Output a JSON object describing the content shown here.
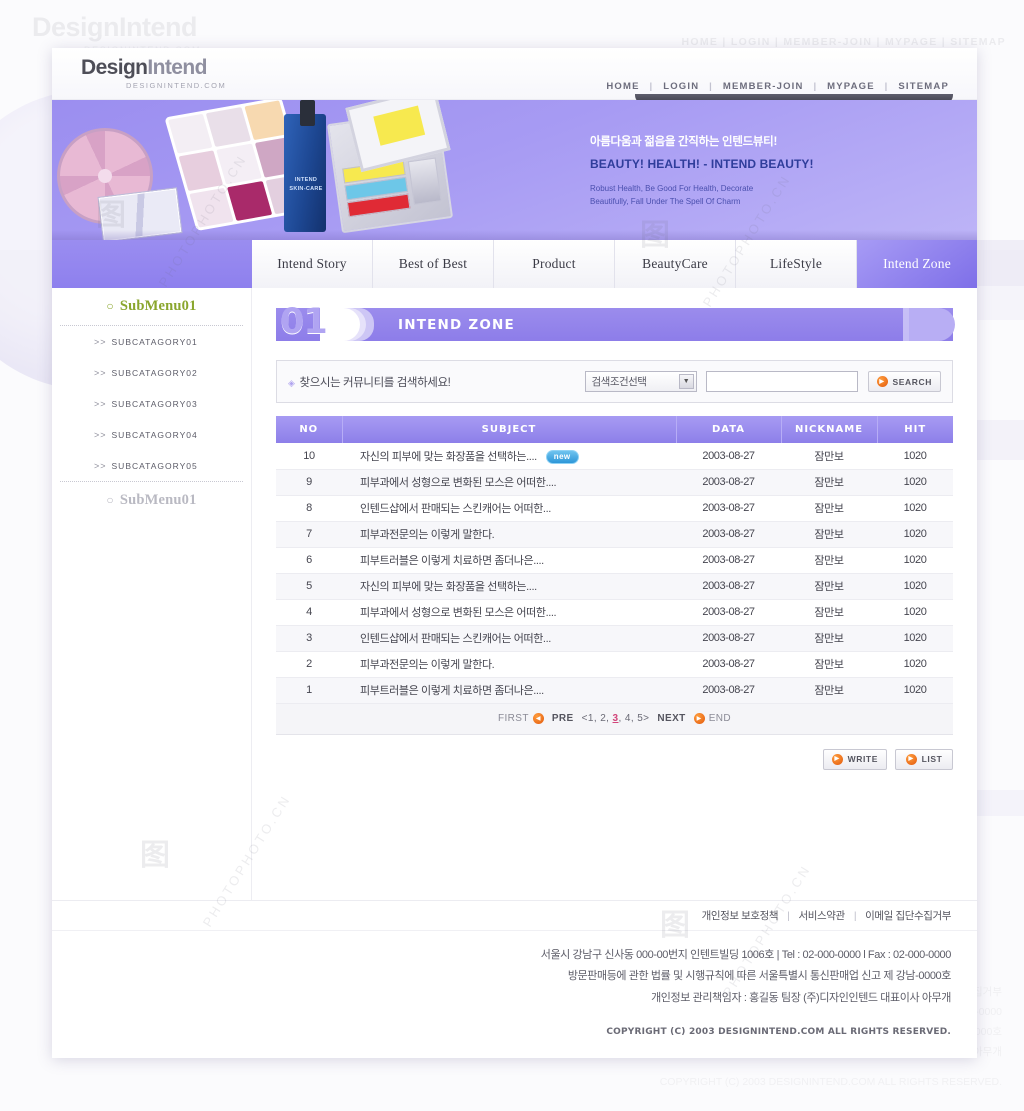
{
  "brand": {
    "name_part1": "Design",
    "name_part2": "Intend",
    "domain": "DESIGNINTEND.COM"
  },
  "topnav": {
    "items": [
      "HOME",
      "LOGIN",
      "MEMBER-JOIN",
      "MYPAGE",
      "SITEMAP"
    ],
    "separator": "|"
  },
  "banner": {
    "slogan_ko": "아름다움과 젊음을 간직하는 인텐드뷰티!",
    "slogan_en": "BEAUTY!  HEALTH! - INTEND BEAUTY!",
    "subtext_line1": "Robust Health, Be Good For  Health, Decorate",
    "subtext_line2": "Beautifully, Fall Under The Spell Of  Charm",
    "bottle_label_line1": "INTEND",
    "bottle_label_line2": "SKIN-CARE"
  },
  "tabs": [
    {
      "label": "Intend Story",
      "active": false
    },
    {
      "label": "Best of Best",
      "active": false
    },
    {
      "label": "Product",
      "active": false
    },
    {
      "label": "BeautyCare",
      "active": false
    },
    {
      "label": "LifeStyle",
      "active": false
    },
    {
      "label": "Intend Zone",
      "active": true
    }
  ],
  "sidebar": {
    "menu_active": "SubMenu01",
    "menu_inactive": "SubMenu01",
    "bullet": "○",
    "arrows": ">>",
    "subitems": [
      "SUBCATAGORY01",
      "SUBCATAGORY02",
      "SUBCATAGORY03",
      "SUBCATAGORY04",
      "SUBCATAGORY05"
    ]
  },
  "page_title": {
    "number": "01",
    "title": "INTEND ZONE"
  },
  "search": {
    "prompt": "찾으시는 커뮤니티를 검색하세요!",
    "bullet": "◈",
    "select_value": "검색조건선택",
    "caret": "▼",
    "input_value": "",
    "input_placeholder": "",
    "button_label": "SEARCH",
    "button_icon": "▶"
  },
  "board": {
    "columns": [
      "NO",
      "SUBJECT",
      "DATA",
      "NICKNAME",
      "HIT"
    ],
    "rows": [
      {
        "no": "10",
        "subject": "자신의 피부에 맞는 화장품을 선택하는....",
        "badge": "new",
        "date": "2003-08-27",
        "nickname": "잠만보",
        "hit": "1020"
      },
      {
        "no": "9",
        "subject": "피부과에서 성형으로 변화된 모스은 어떠한....",
        "badge": "",
        "date": "2003-08-27",
        "nickname": "잠만보",
        "hit": "1020"
      },
      {
        "no": "8",
        "subject": "인텐드샵에서 판매되는 스킨캐어는 어떠한...",
        "badge": "",
        "date": "2003-08-27",
        "nickname": "잠만보",
        "hit": "1020"
      },
      {
        "no": "7",
        "subject": "피부과전문의는 이렇게 말한다.",
        "badge": "",
        "date": "2003-08-27",
        "nickname": "잠만보",
        "hit": "1020"
      },
      {
        "no": "6",
        "subject": "피부트러블은 이렇게 치료하면 좀더나은....",
        "badge": "",
        "date": "2003-08-27",
        "nickname": "잠만보",
        "hit": "1020"
      },
      {
        "no": "5",
        "subject": "자신의 피부에 맞는 화장품을 선택하는....",
        "badge": "",
        "date": "2003-08-27",
        "nickname": "잠만보",
        "hit": "1020"
      },
      {
        "no": "4",
        "subject": "피부과에서 성형으로 변화된 모스은 어떠한....",
        "badge": "",
        "date": "2003-08-27",
        "nickname": "잠만보",
        "hit": "1020"
      },
      {
        "no": "3",
        "subject": "인텐드샵에서 판매되는 스킨캐어는 어떠한...",
        "badge": "",
        "date": "2003-08-27",
        "nickname": "잠만보",
        "hit": "1020"
      },
      {
        "no": "2",
        "subject": "피부과전문의는 이렇게 말한다.",
        "badge": "",
        "date": "2003-08-27",
        "nickname": "잠만보",
        "hit": "1020"
      },
      {
        "no": "1",
        "subject": "피부트러블은 이렇게 치료하면 좀더나은....",
        "badge": "",
        "date": "2003-08-27",
        "nickname": "잠만보",
        "hit": "1020"
      }
    ]
  },
  "pager": {
    "first": "FIRST",
    "prev": "PRE",
    "pages_open": "<",
    "pages": [
      "1",
      "2",
      "3",
      "4",
      "5"
    ],
    "current_page": "3",
    "pages_close": ">",
    "next": "NEXT",
    "end": "END",
    "prev_icon": "◀",
    "next_icon": "▶"
  },
  "actions": {
    "write_label": "WRITE",
    "list_label": "LIST",
    "icon": "▶"
  },
  "footer": {
    "links": [
      "개인정보 보호정책",
      "서비스약관",
      "이메일 집단수집거부"
    ],
    "separator": "|",
    "info_line1": "서울시  강남구 신사동 000-00번지  인텐트빌딩 1006호   | Tel : 02-000-0000 l Fax : 02-000-0000",
    "info_line2": "방문판매등에 관한 법률 및 시행규칙에 따른 서울특별시 통신판매업 신고 제 강남-0000호",
    "info_line3": "개인정보 관리책임자 : 홍길동 팀장 (주)디자인인텐드 대표이사 아무개",
    "copyright": "COPYRIGHT (C) 2003 DESIGNINTEND.COM ALL RIGHTS RESERVED."
  },
  "colors": {
    "accent_purple": "#8d7fe9",
    "banner_purple": "#9b8ef0",
    "active_green": "#8aa62d",
    "orange": "#e2590c",
    "badge_blue": "#2d96d8",
    "current_page_pink": "#d2457a"
  }
}
